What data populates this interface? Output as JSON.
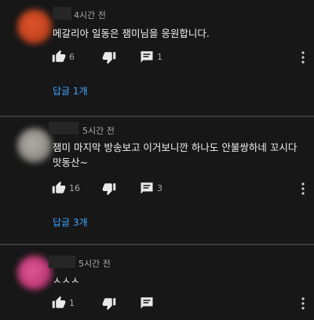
{
  "colors": {
    "background": "#171717",
    "text": "#f1f1f1",
    "meta": "#aaaaaa",
    "link": "#3ea6ff"
  },
  "comments": [
    {
      "avatar_color": "#c2431f",
      "time": "4시간 전",
      "text": "메갈리아 일동은 잼미님을 응원합니다.",
      "likes": "6",
      "reply_count": "1",
      "replies_link": "답글 1개"
    },
    {
      "avatar_color": "#8f8c86",
      "time": "5시간 전",
      "text": "잼미 마지막 방송보고 이거보니깐 하나도 안불쌍하네 꼬시다 맛동산~",
      "likes": "16",
      "reply_count": "3",
      "replies_link": "답글 3개"
    },
    {
      "avatar_color": "#c23a78",
      "time": "5시간 전",
      "text": "ㅅㅅㅅ",
      "likes": "1",
      "reply_count": "",
      "replies_link": ""
    }
  ],
  "icons": {
    "like": "thumbs-up-icon",
    "dislike": "thumbs-down-icon",
    "reply": "comment-icon",
    "more": "more-vert-icon"
  }
}
